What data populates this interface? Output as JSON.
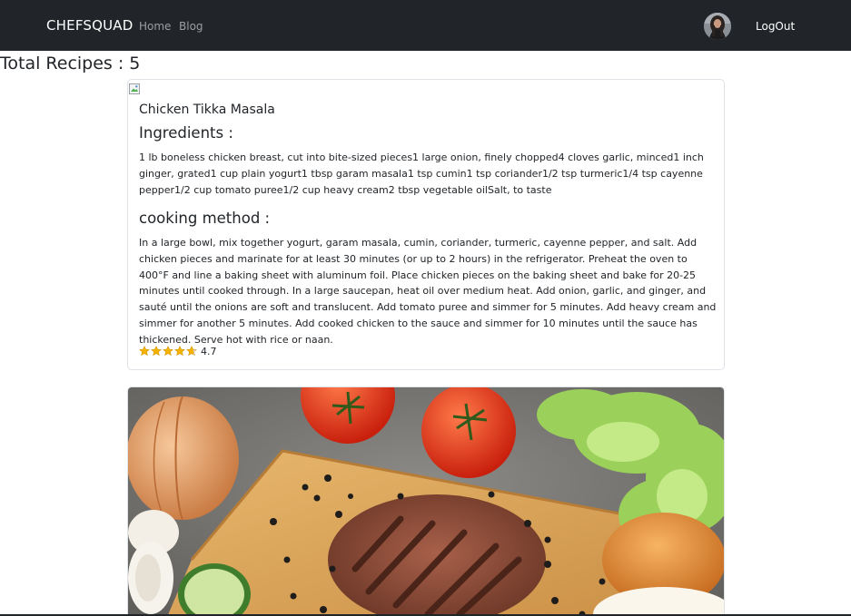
{
  "navbar": {
    "brand": "CHEFSQUAD",
    "links": [
      "Home",
      "Blog"
    ],
    "logout_label": "LogOut"
  },
  "page": {
    "total_label": "Total Recipes : 5"
  },
  "recipes": [
    {
      "title": "Chicken Tikka Masala",
      "ingredients_heading": "Ingredients :",
      "ingredients": "1 lb boneless chicken breast, cut into bite-sized pieces1 large onion, finely chopped4 cloves garlic, minced1 inch ginger, grated1 cup plain yogurt1 tbsp garam masala1 tsp cumin1 tsp coriander1/2 tsp turmeric1/4 tsp cayenne pepper1/2 cup tomato puree1/2 cup heavy cream2 tbsp vegetable oilSalt, to taste",
      "method_heading": "cooking method :",
      "method": "In a large bowl, mix together yogurt, garam masala, cumin, coriander, turmeric, cayenne pepper, and salt. Add chicken pieces and marinate for at least 30 minutes (or up to 2 hours) in the refrigerator. Preheat the oven to 400°F and line a baking sheet with aluminum foil. Place chicken pieces on the baking sheet and bake for 20-25 minutes until cooked through. In a large saucepan, heat oil over medium heat. Add onion, garlic, and ginger, and sauté until the onions are soft and translucent. Add tomato puree and simmer for 5 minutes. Add heavy cream and simmer for another 5 minutes. Add cooked chicken to the sauce and simmer for 10 minutes until the sauce has thickened. Serve hot with rice or naan.",
      "rating": "4.7",
      "rating_stars": 4.7
    }
  ],
  "colors": {
    "navbar_bg": "#212529",
    "star": "#f5b301"
  },
  "icons": [
    "broken-image-icon",
    "star-icon",
    "avatar"
  ]
}
